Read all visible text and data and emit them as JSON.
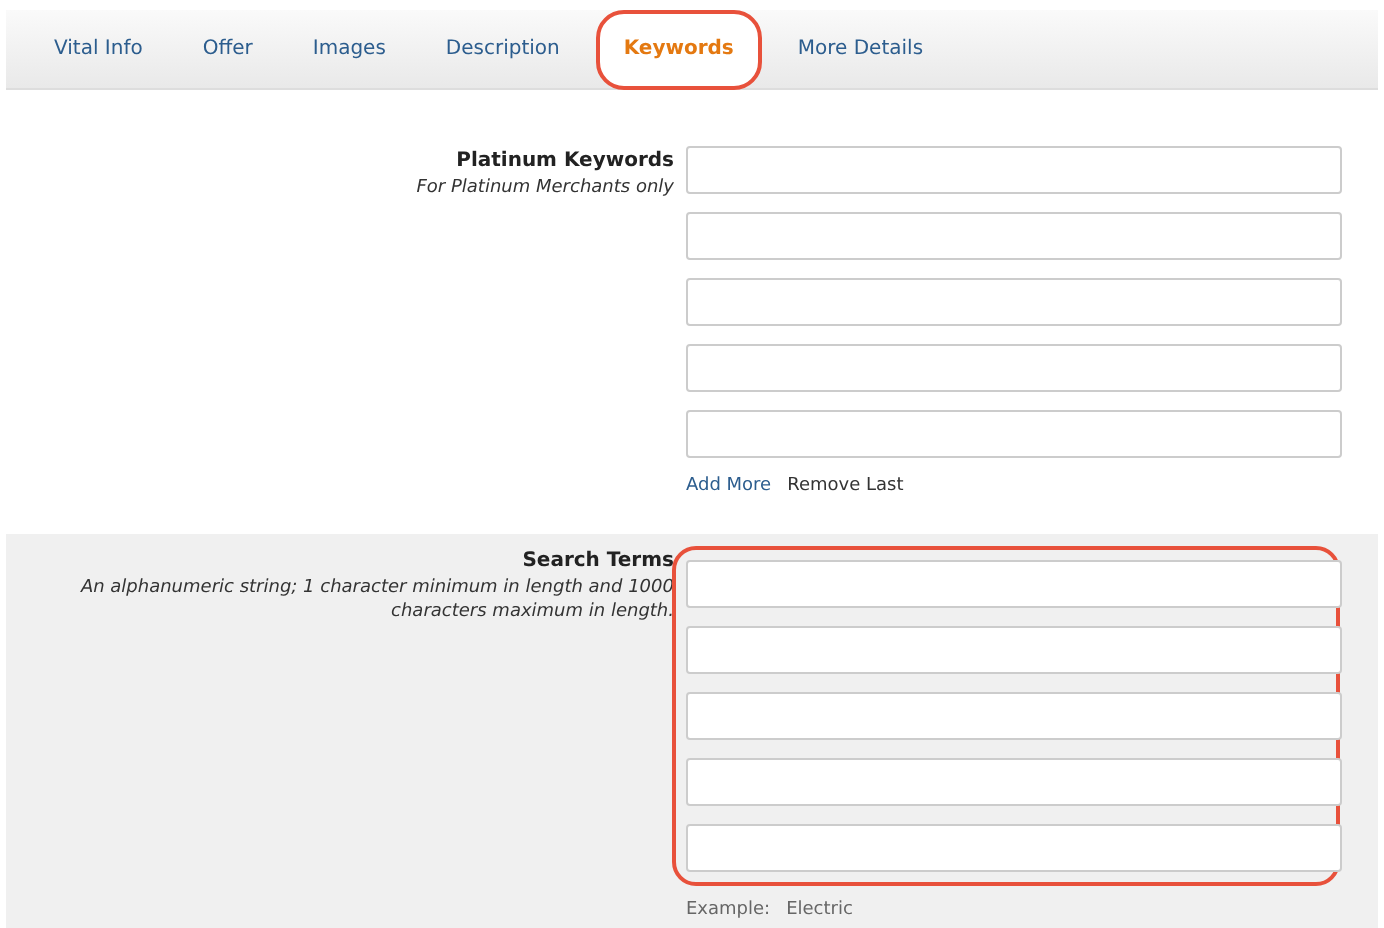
{
  "tabs": [
    {
      "label": "Vital Info",
      "selected": false,
      "highlighted": false
    },
    {
      "label": "Offer",
      "selected": false,
      "highlighted": false
    },
    {
      "label": "Images",
      "selected": false,
      "highlighted": false
    },
    {
      "label": "Description",
      "selected": false,
      "highlighted": false
    },
    {
      "label": "Keywords",
      "selected": true,
      "highlighted": true
    },
    {
      "label": "More Details",
      "selected": false,
      "highlighted": false
    }
  ],
  "sections": [
    {
      "title": "Platinum Keywords",
      "hint": "For Platinum Merchants only",
      "shaded": false,
      "highlighted": false,
      "fields": [
        {
          "kind": "text"
        },
        {
          "kind": "text"
        },
        {
          "kind": "text"
        },
        {
          "kind": "text"
        },
        {
          "kind": "text"
        }
      ],
      "links": [
        "Add More",
        "Remove Last"
      ]
    },
    {
      "title": "Search Terms",
      "hint": "An alphanumeric string; 1 character minimum in length and 1000 characters maximum in length.",
      "shaded": true,
      "highlighted": true,
      "fields": [
        {
          "kind": "text"
        },
        {
          "kind": "text"
        },
        {
          "kind": "text"
        },
        {
          "kind": "text"
        },
        {
          "kind": "text"
        }
      ],
      "example": {
        "label": "Example:",
        "value": "Electric"
      }
    }
  ]
}
